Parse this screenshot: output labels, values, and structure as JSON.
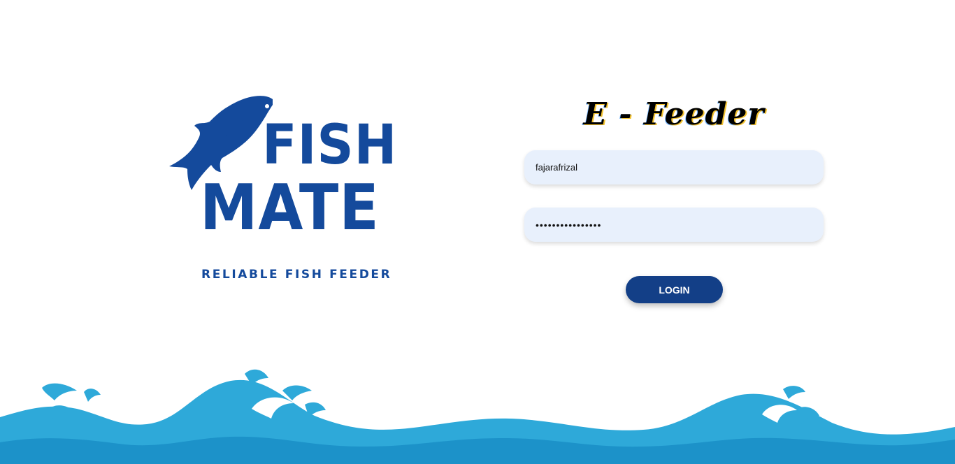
{
  "brand": {
    "logo_word_1": "FISH",
    "logo_word_2": "MATE",
    "tagline": "RELIABLE FISH FEEDER",
    "color": "#144a9c"
  },
  "app": {
    "title": "E - Feeder"
  },
  "login_form": {
    "username_value": "fajarafrizal",
    "password_value": "••••••••••••••••",
    "submit_label": "LOGIN",
    "button_color": "#133f87",
    "field_bg": "#e8f0fc"
  },
  "decor": {
    "wave_colors": [
      "#2ea9d9",
      "#1c92c9"
    ]
  }
}
